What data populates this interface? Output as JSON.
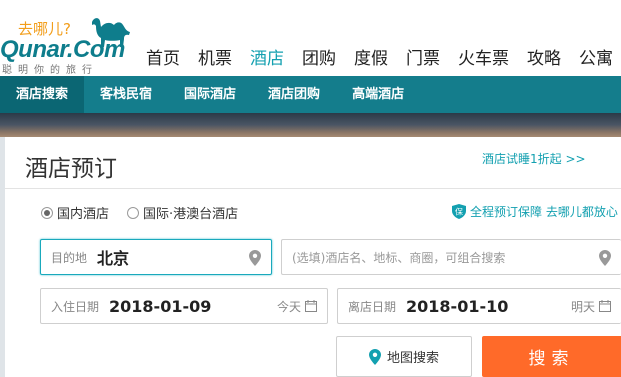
{
  "logo": {
    "slogan": "去哪儿?",
    "wordmark": "Qunar.Com",
    "tagline": "聪明你的旅行",
    "brand_color": "#0e7d8c",
    "slogan_color": "#f29e1b"
  },
  "main_nav": {
    "items": [
      {
        "label": "首页",
        "active": false
      },
      {
        "label": "机票",
        "active": false
      },
      {
        "label": "酒店",
        "active": true
      },
      {
        "label": "团购",
        "active": false
      },
      {
        "label": "度假",
        "active": false
      },
      {
        "label": "门票",
        "active": false
      },
      {
        "label": "火车票",
        "active": false
      },
      {
        "label": "攻略",
        "active": false
      },
      {
        "label": "公寓",
        "active": false
      }
    ],
    "active_color": "#13a0b0"
  },
  "sub_nav": {
    "items": [
      {
        "label": "酒店搜索",
        "active": true
      },
      {
        "label": "客栈民宿",
        "active": false
      },
      {
        "label": "国际酒店",
        "active": false
      },
      {
        "label": "酒店团购",
        "active": false
      },
      {
        "label": "高端酒店",
        "active": false
      }
    ],
    "bg_color": "#147d8c"
  },
  "booking": {
    "title": "酒店预订",
    "promo_link": "酒店试睡1折起 >>",
    "radios": [
      {
        "label": "国内酒店",
        "checked": true
      },
      {
        "label": "国际·港澳台酒店",
        "checked": false
      }
    ],
    "guarantee": "全程预订保障 去哪儿都放心",
    "guarantee_icon_text": "保",
    "destination": {
      "label": "目的地",
      "value": "北京"
    },
    "keyword": {
      "placeholder": "(选填)酒店名、地标、商圈，可组合搜索"
    },
    "checkin": {
      "label": "入住日期",
      "value": "2018-01-09",
      "hint": "今天"
    },
    "checkout": {
      "label": "离店日期",
      "value": "2018-01-10",
      "hint": "明天"
    },
    "map_button": "地图搜索",
    "search_button": "搜索",
    "search_color": "#ff6a29"
  }
}
